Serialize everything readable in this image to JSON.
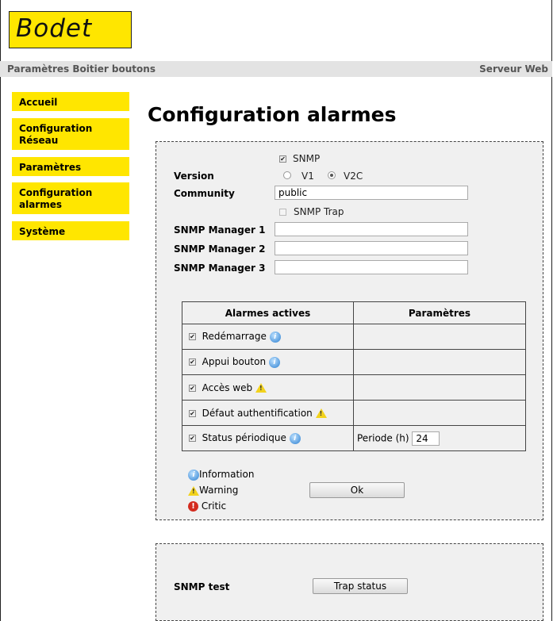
{
  "logo": {
    "text": "Bodet"
  },
  "topbar": {
    "left": "Paramètres Boitier boutons",
    "right": "Serveur Web"
  },
  "nav": [
    {
      "label": "Accueil"
    },
    {
      "label": "Configuration Réseau"
    },
    {
      "label": "Paramètres"
    },
    {
      "label": "Configuration alarmes"
    },
    {
      "label": "Système"
    }
  ],
  "page_title": "Configuration alarmes",
  "snmp": {
    "snmp_label": "SNMP",
    "snmp_checked": true,
    "version_label": "Version",
    "v1_label": "V1",
    "v2c_label": "V2C",
    "version_selected": "V2C",
    "community_label": "Community",
    "community_value": "public",
    "trap_label": "SNMP Trap",
    "trap_checked": false,
    "manager1_label": "SNMP Manager 1",
    "manager2_label": "SNMP Manager 2",
    "manager3_label": "SNMP Manager 3",
    "manager1_value": "",
    "manager2_value": "",
    "manager3_value": ""
  },
  "alarms": {
    "col_active": "Alarmes actives",
    "col_params": "Paramètres",
    "rows": [
      {
        "label": "Redémarrage",
        "icon": "info-icon",
        "checked": true
      },
      {
        "label": "Appui bouton",
        "icon": "info-icon",
        "checked": true
      },
      {
        "label": "Accès web",
        "icon": "warning-icon",
        "checked": true
      },
      {
        "label": "Défaut authentification",
        "icon": "warning-icon",
        "checked": true
      },
      {
        "label": "Status périodique",
        "icon": "info-icon",
        "checked": true
      }
    ],
    "period_label": "Periode (h)",
    "period_value": "24"
  },
  "legend": {
    "information": "Information",
    "warning": "Warning",
    "critic": "Critic"
  },
  "ok_button": "Ok",
  "snmp_test": {
    "label": "SNMP test",
    "button": "Trap status"
  },
  "colors": {
    "nav_bg": "#ffe600",
    "panel_bg": "#f0f0f0",
    "topbar_bg": "#e3e3e3"
  }
}
